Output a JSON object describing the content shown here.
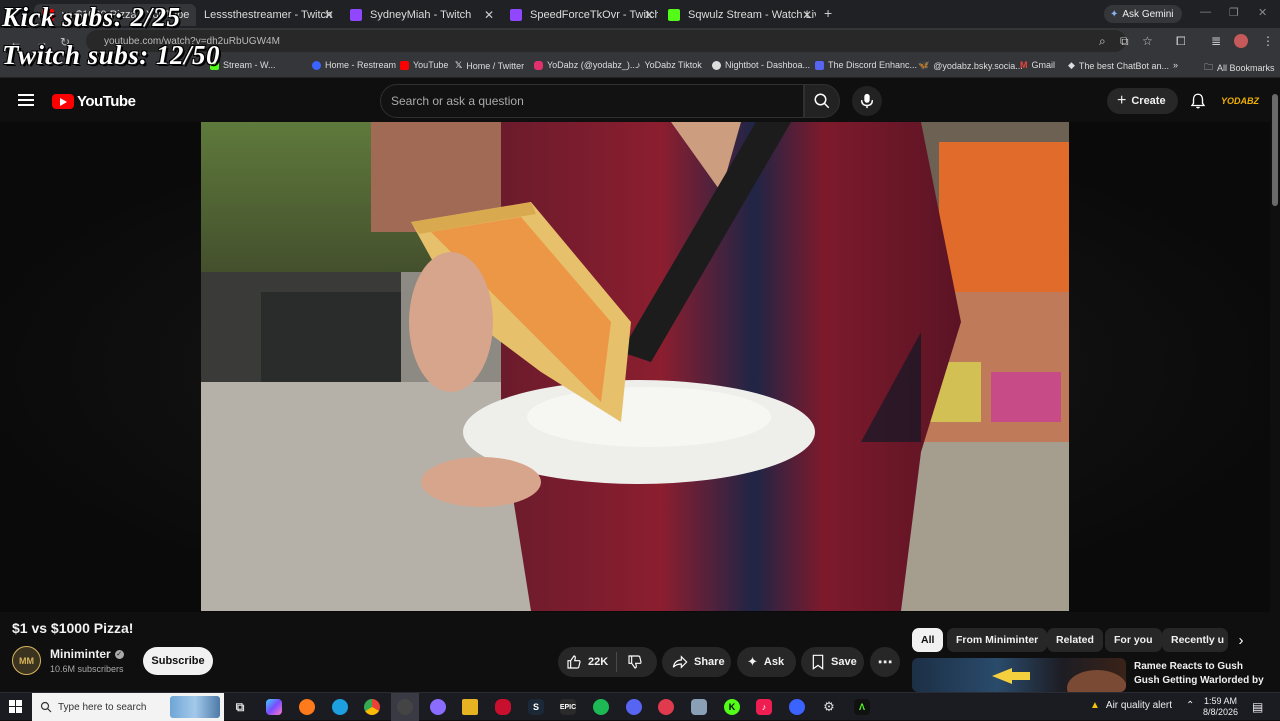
{
  "browser": {
    "tabs": [
      {
        "label": "vs $1000 Pizza - YouTube",
        "color": "#ff0000",
        "active": true
      },
      {
        "label": "Lesssthestreamer - Twitch",
        "color": "#9146ff",
        "active": false
      },
      {
        "label": "SydneyMiah - Twitch",
        "color": "#9146ff",
        "active": false
      },
      {
        "label": "SpeedForceTkOvr - Twitch",
        "color": "#9146ff",
        "active": false
      },
      {
        "label": "Sqwulz Stream - Watch Live on",
        "color": "#53fc18",
        "active": false
      }
    ],
    "new_tab": "+",
    "ask_gemini": "Ask Gemini",
    "url": "youtube.com/watch?v=dh2uRbUGW4M",
    "bookmarks": [
      {
        "label": "Stream - W...",
        "color": "#53fc18"
      },
      {
        "label": "Home - Restream",
        "color": "#3b63ff"
      },
      {
        "label": "YouTube",
        "color": "#ff0000"
      },
      {
        "label": "Home / Twitter",
        "color": "#ffffff"
      },
      {
        "label": "YoDabz (@yodabz_)...",
        "color": "#e1306c"
      },
      {
        "label": "YoDabz Tiktok",
        "color": "#25f4ee"
      },
      {
        "label": "Nightbot - Dashboa...",
        "color": "#dddddd"
      },
      {
        "label": "The Discord Enhanc...",
        "color": "#5865f2"
      },
      {
        "label": "@yodabz.bsky.socia...",
        "color": "#1185fe"
      },
      {
        "label": "Gmail",
        "color": "#ea4335"
      },
      {
        "label": "The best ChatBot an...",
        "color": "#ffffff"
      }
    ],
    "all_bookmarks": "All Bookmarks"
  },
  "overlay": {
    "kick_subs": "Kick subs: 2/25",
    "twitch_subs": "Twitch subs: 12/50"
  },
  "youtube": {
    "logo_text": "YouTube",
    "search_placeholder": "Search or ask a question",
    "create_label": "Create",
    "account_badge": "YODABZ",
    "video": {
      "title": "$1 vs $1000 Pizza!",
      "channel": "Miniminter",
      "channel_initials": "MM",
      "subscribers": "10.6M subscribers",
      "subscribe_label": "Subscribe",
      "likes": "22K",
      "share_label": "Share",
      "ask_label": "Ask",
      "save_label": "Save"
    },
    "chips": [
      {
        "label": "All",
        "active": true
      },
      {
        "label": "From Miniminter",
        "active": false
      },
      {
        "label": "Related",
        "active": false
      },
      {
        "label": "For you",
        "active": false
      },
      {
        "label": "Recently u",
        "active": false
      }
    ],
    "recommendation": {
      "title": "Ramee Reacts to Gush Gush Getting Warlorded by"
    }
  },
  "taskbar": {
    "search_placeholder": "Type here to search",
    "air_quality": "Air quality alert",
    "time": "1:59 AM",
    "date": "8/8/2026"
  },
  "colors": {
    "youtube_red": "#ff0000",
    "background": "#0f0f0f",
    "kick_green": "#53fc18",
    "twitch_purple": "#9146ff"
  }
}
